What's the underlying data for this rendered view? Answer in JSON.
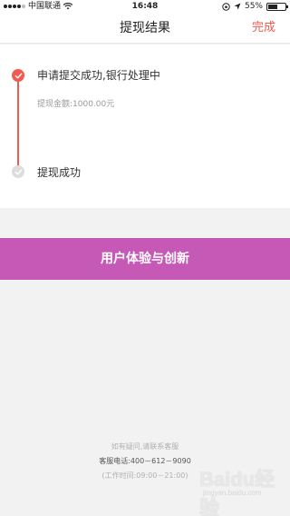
{
  "status_bar": {
    "carrier": "中国联通",
    "time": "16:48",
    "battery_text": "55%",
    "battery_level": 0.55
  },
  "nav": {
    "title": "提现结果",
    "done_label": "完成"
  },
  "steps": [
    {
      "title": "申请提交成功,银行处理中",
      "detail": "提现金额:1000.00元",
      "status": "done"
    },
    {
      "title": "提现成功",
      "status": "pending"
    }
  ],
  "banner": {
    "text": "用户体验与创新"
  },
  "footer": {
    "hint": "如有疑问,请联系客服",
    "phone": "客服电话:400－612－9090",
    "hours": "(工作时间:09:00－21:00)"
  },
  "watermark": {
    "brand": "Baidu经验",
    "url": "jingyan.baidu.com"
  },
  "colors": {
    "accent": "#f05a4f",
    "banner": "#c659b6",
    "inactive": "#dddddd"
  }
}
